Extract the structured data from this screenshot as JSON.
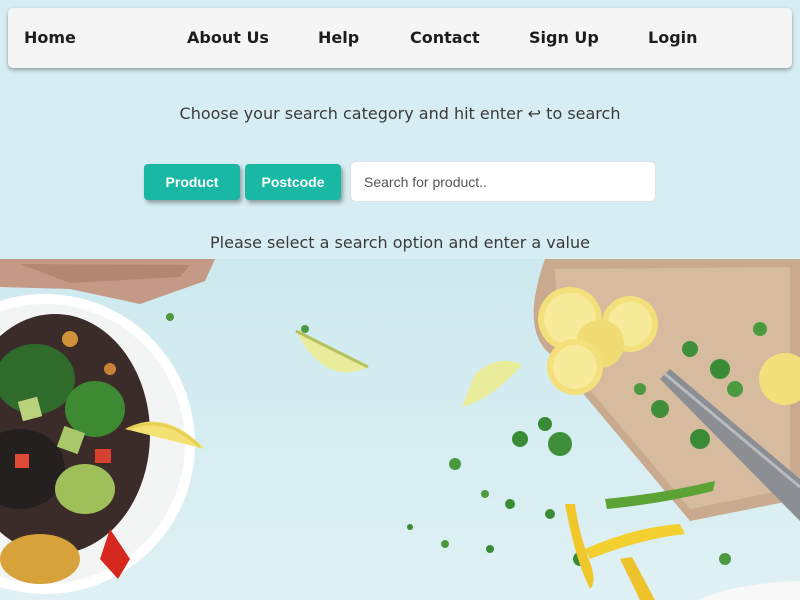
{
  "nav": {
    "items": [
      {
        "label": "Home"
      },
      {
        "label": "About Us"
      },
      {
        "label": "Help"
      },
      {
        "label": "Contact"
      },
      {
        "label": "Sign Up"
      },
      {
        "label": "Login"
      }
    ]
  },
  "search": {
    "instruction": "Choose your search category and hit enter ↩ to search",
    "options": [
      {
        "label": "Product"
      },
      {
        "label": "Postcode"
      }
    ],
    "placeholder": "Search for product..",
    "value": "",
    "status": "Please select a search option and enter a value"
  },
  "colors": {
    "background": "#d6eef3",
    "navbar": "#f5f5f5",
    "button": "#19b8a5",
    "text": "#3a3a3a"
  },
  "hero_image": {
    "subject": "food-flatlay-photo"
  }
}
